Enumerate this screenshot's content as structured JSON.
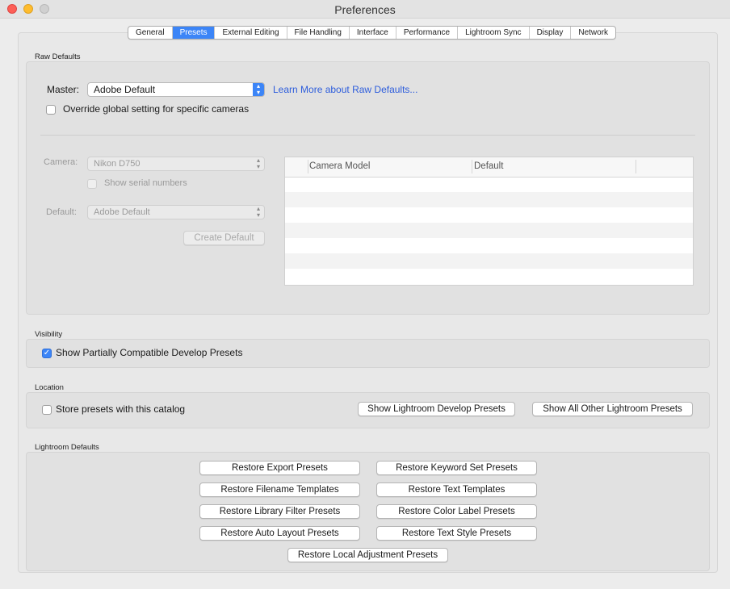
{
  "window": {
    "title": "Preferences"
  },
  "tabs": [
    {
      "label": "General"
    },
    {
      "label": "Presets"
    },
    {
      "label": "External Editing"
    },
    {
      "label": "File Handling"
    },
    {
      "label": "Interface"
    },
    {
      "label": "Performance"
    },
    {
      "label": "Lightroom Sync"
    },
    {
      "label": "Display"
    },
    {
      "label": "Network"
    }
  ],
  "active_tab": "Presets",
  "raw_defaults": {
    "section_label": "Raw Defaults",
    "master_label": "Master:",
    "master_value": "Adobe Default",
    "learn_more": "Learn More about Raw Defaults...",
    "override_label": "Override global setting for specific cameras",
    "override_checked": false,
    "camera_label": "Camera:",
    "camera_value": "Nikon D750",
    "serial_label": "Show serial numbers",
    "default_label": "Default:",
    "default_value": "Adobe Default",
    "create_default": "Create Default",
    "table_columns": [
      "Camera Model",
      "Default"
    ]
  },
  "visibility": {
    "section_label": "Visibility",
    "show_partial_label": "Show Partially Compatible Develop Presets",
    "show_partial_checked": true
  },
  "location": {
    "section_label": "Location",
    "store_label": "Store presets with this catalog",
    "store_checked": false,
    "show_develop": "Show Lightroom Develop Presets",
    "show_other": "Show All Other Lightroom Presets"
  },
  "lightroom_defaults": {
    "section_label": "Lightroom Defaults",
    "buttons": [
      "Restore Export Presets",
      "Restore Keyword Set Presets",
      "Restore Filename Templates",
      "Restore Text Templates",
      "Restore Library Filter Presets",
      "Restore Color Label Presets",
      "Restore Auto Layout Presets",
      "Restore Text Style Presets",
      "Restore Local Adjustment Presets"
    ]
  },
  "colors": {
    "accent": "#3c85f7",
    "link": "#2d5ddc",
    "window_bg": "#ececec"
  }
}
